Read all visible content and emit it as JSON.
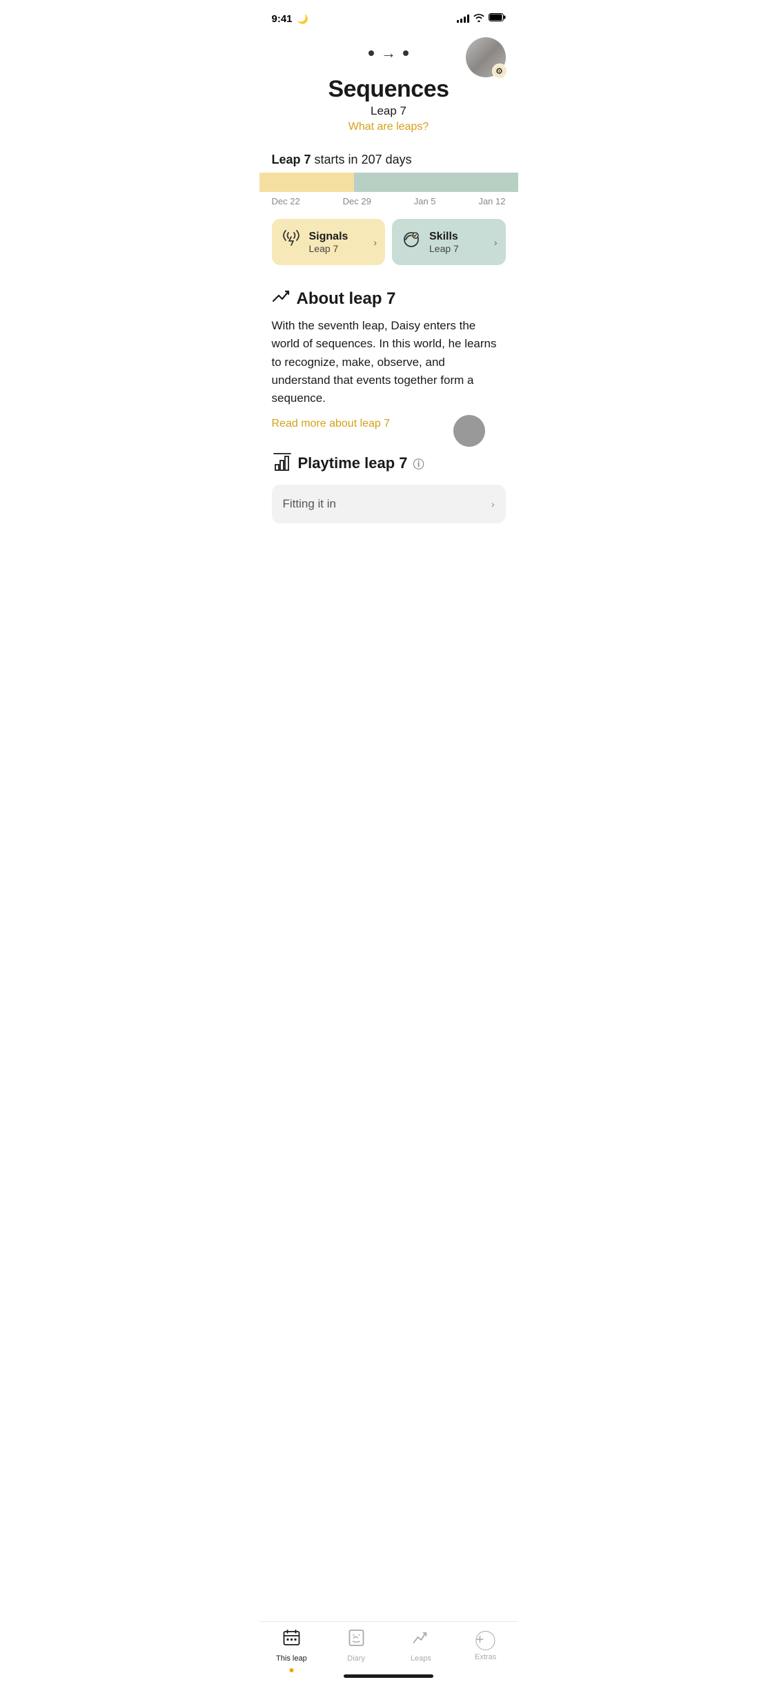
{
  "statusBar": {
    "time": "9:41",
    "moonIcon": "🌙"
  },
  "navigation": {
    "dotLeft": "•",
    "arrow": "→",
    "dotRight": "•"
  },
  "profile": {
    "gearIcon": "⚙"
  },
  "titleSection": {
    "title": "Sequences",
    "leapLabel": "Leap 7",
    "whatAreLeaps": "What are leaps?"
  },
  "leapInfo": {
    "leapBold": "Leap 7",
    "startsIn": "starts in 207 days"
  },
  "timelineDates": {
    "date1": "Dec 22",
    "date2": "Dec 29",
    "date3": "Jan 5",
    "date4": "Jan 12"
  },
  "cards": [
    {
      "id": "signals",
      "icon": "⛈",
      "label": "Signals",
      "sublabel": "Leap 7",
      "chevron": "›"
    },
    {
      "id": "skills",
      "icon": "⛅",
      "label": "Skills",
      "sublabel": "Leap 7",
      "chevron": "›"
    }
  ],
  "about": {
    "trendIcon": "↗",
    "title": "About leap 7",
    "text": "With the seventh leap, Daisy  enters the world of sequences. In this world, he learns to recognize, make, observe, and understand that events together form a sequence.",
    "readMore": "Read more about leap 7"
  },
  "playtime": {
    "icon": "🏗",
    "title": "Playtime leap 7",
    "infoIcon": "ⓘ",
    "fittingCard": {
      "text": "Fitting it in",
      "chevron": "›"
    }
  },
  "tabBar": {
    "tabs": [
      {
        "id": "this-leap",
        "label": "This leap",
        "active": true,
        "hasDot": true
      },
      {
        "id": "diary",
        "label": "Diary",
        "active": false,
        "hasDot": false
      },
      {
        "id": "leaps",
        "label": "Leaps",
        "active": false,
        "hasDot": false
      },
      {
        "id": "extras",
        "label": "Extras",
        "active": false,
        "hasDot": false
      }
    ]
  }
}
